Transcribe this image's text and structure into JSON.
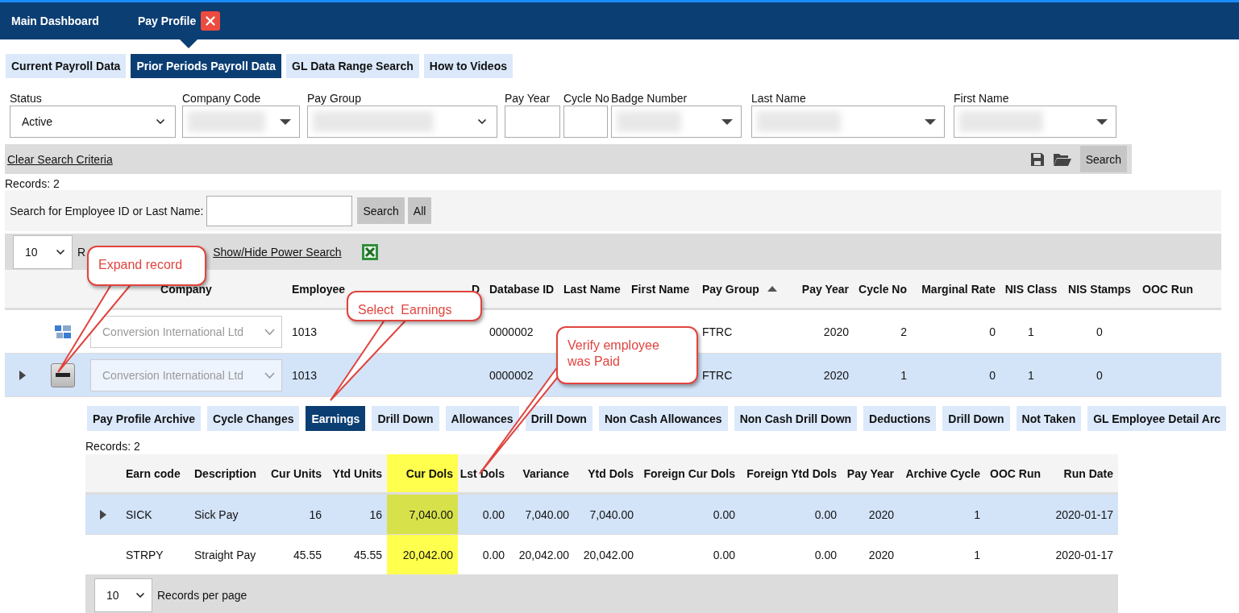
{
  "topbar": {
    "items": [
      {
        "label": "Main Dashboard",
        "selected": false,
        "closable": false
      },
      {
        "label": "Pay Profile",
        "selected": true,
        "closable": true
      }
    ]
  },
  "tabs": [
    {
      "label": "Current Payroll Data",
      "selected": false
    },
    {
      "label": "Prior Periods Payroll Data",
      "selected": true
    },
    {
      "label": "GL Data Range Search",
      "selected": false
    },
    {
      "label": "How to Videos",
      "selected": false
    }
  ],
  "filters": [
    {
      "label": "Status",
      "kind": "dropdown",
      "value": "Active"
    },
    {
      "label": "Company Code",
      "kind": "combobox",
      "redacted": true
    },
    {
      "label": "Pay Group",
      "kind": "dropdown",
      "redacted": true
    },
    {
      "label": "Pay Year",
      "kind": "input"
    },
    {
      "label": "Cycle No",
      "kind": "input"
    },
    {
      "label": "Badge Number",
      "kind": "combobox",
      "redacted": true
    },
    {
      "label": "Last Name",
      "kind": "combobox",
      "redacted": true
    },
    {
      "label": "First Name",
      "kind": "combobox",
      "redacted": true
    }
  ],
  "criteria_bar": {
    "clear_link": "Clear Search Criteria",
    "search_button": "Search"
  },
  "records_label": "Records:  2",
  "quick_search": {
    "label": "Search for Employee ID or Last Name:",
    "search_button": "Search",
    "all_button": "All"
  },
  "pager": {
    "page_size": "10",
    "label": "R",
    "power_search_link": "Show/Hide Power Search"
  },
  "table": {
    "columns": [
      {
        "label": "Company"
      },
      {
        "label": "Employee"
      },
      {
        "label": "D"
      },
      {
        "label": "Database ID"
      },
      {
        "label": "Last Name"
      },
      {
        "label": "First Name"
      },
      {
        "label": "Pay Group",
        "sorted": true
      },
      {
        "label": "Pay Year"
      },
      {
        "label": "Cycle No"
      },
      {
        "label": "Marginal Rate"
      },
      {
        "label": "NIS Class"
      },
      {
        "label": "NIS Stamps"
      },
      {
        "label": "OOC Run"
      }
    ],
    "rows": [
      {
        "selected": false,
        "expander": false,
        "kind": "grid",
        "company_disabled": true,
        "cells": [
          "Conversion International Ltd",
          "1013",
          null,
          "0000002",
          null,
          null,
          "FTRC",
          "2020",
          "2",
          "0",
          "1",
          "0",
          null
        ]
      },
      {
        "selected": true,
        "expander": true,
        "kind": "collapse",
        "company_disabled": true,
        "cells": [
          "Conversion International Ltd",
          "1013",
          null,
          "0000002",
          null,
          null,
          "FTRC",
          "2020",
          "1",
          "0",
          "1",
          "0",
          null
        ]
      }
    ]
  },
  "detail_tabs": [
    {
      "label": "Pay Profile Archive",
      "selected": false
    },
    {
      "label": "Cycle Changes",
      "selected": false
    },
    {
      "label": "Earnings",
      "selected": true
    },
    {
      "label": "Drill Down",
      "selected": false
    },
    {
      "label": "Allowances",
      "selected": false
    },
    {
      "label": "Drill Down",
      "selected": false
    },
    {
      "label": "Non Cash Allowances",
      "selected": false
    },
    {
      "label": "Non Cash Drill Down",
      "selected": false
    },
    {
      "label": "Deductions",
      "selected": false
    },
    {
      "label": "Drill Down",
      "selected": false
    },
    {
      "label": "Not Taken",
      "selected": false
    },
    {
      "label": "GL Employee Detail Arc",
      "selected": false
    }
  ],
  "earnings": {
    "records_label": "Records:  2",
    "columns": [
      {
        "label": "Earn code",
        "highlighted": false
      },
      {
        "label": "Description",
        "highlighted": false
      },
      {
        "label": "Cur Units",
        "highlighted": false
      },
      {
        "label": "Ytd Units",
        "highlighted": false
      },
      {
        "label": "Cur Dols",
        "highlighted": true
      },
      {
        "label": "Lst Dols",
        "highlighted": false
      },
      {
        "label": "Variance",
        "highlighted": false
      },
      {
        "label": "Ytd Dols",
        "highlighted": false
      },
      {
        "label": "Foreign Cur Dols",
        "highlighted": false
      },
      {
        "label": "Foreign Ytd Dols",
        "highlighted": false
      },
      {
        "label": "Pay Year",
        "highlighted": false
      },
      {
        "label": "Archive Cycle",
        "highlighted": false
      },
      {
        "label": "OOC Run",
        "highlighted": false
      },
      {
        "label": "Run Date",
        "highlighted": false
      }
    ],
    "rows": [
      {
        "selected": true,
        "expander": true,
        "cells": [
          "SICK",
          "Sick Pay",
          "16",
          "16",
          "7,040.00",
          "0.00",
          "7,040.00",
          "7,040.00",
          "0.00",
          "0.00",
          "2020",
          "1",
          null,
          "2020-01-17"
        ]
      },
      {
        "selected": false,
        "expander": false,
        "cells": [
          "STRPY",
          "Straight Pay",
          "45.55",
          "45.55",
          "20,042.00",
          "0.00",
          "20,042.00",
          "20,042.00",
          "0.00",
          "0.00",
          "2020",
          "1",
          null,
          "2020-01-17"
        ]
      }
    ],
    "page_size": "10",
    "per_page_label": "Records per page"
  },
  "callouts": [
    {
      "text": "Expand record"
    },
    {
      "text": "Select  Earnings"
    },
    {
      "text": "Verify employee was Paid"
    }
  ]
}
